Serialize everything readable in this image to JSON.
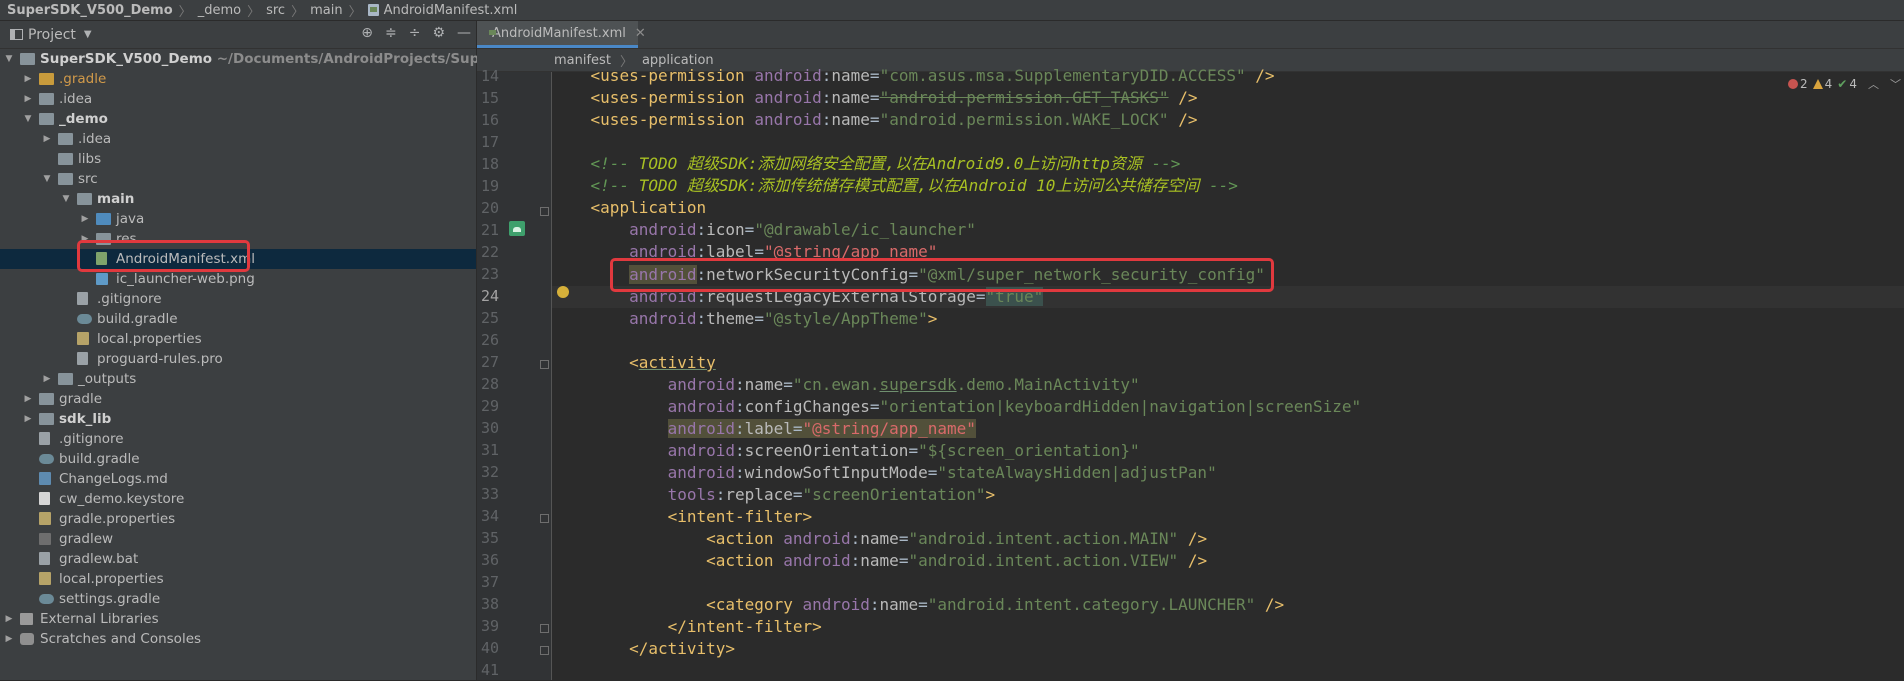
{
  "breadcrumb": {
    "items": [
      "SuperSDK_V500_Demo",
      "_demo",
      "src",
      "main",
      "AndroidManifest.xml"
    ]
  },
  "project_panel": {
    "title": "Project",
    "tree": [
      {
        "label": "SuperSDK_V500_Demo",
        "hint": "~/Documents/AndroidProjects/SuperSDK/_d",
        "bold": true,
        "arrow": "open",
        "icon": "folder"
      },
      {
        "label": ".gradle",
        "orange": true,
        "arrow": "closed",
        "icon": "folder-y"
      },
      {
        "label": ".idea",
        "arrow": "closed",
        "icon": "folder"
      },
      {
        "label": "_demo",
        "bold": true,
        "arrow": "open",
        "icon": "folder-m"
      },
      {
        "label": ".idea",
        "arrow": "closed",
        "icon": "folder"
      },
      {
        "label": "libs",
        "arrow": "none",
        "icon": "folder"
      },
      {
        "label": "src",
        "arrow": "open",
        "icon": "folder"
      },
      {
        "label": "main",
        "bold": true,
        "arrow": "open",
        "icon": "folder-m"
      },
      {
        "label": "java",
        "arrow": "closed",
        "icon": "folder-b"
      },
      {
        "label": "res",
        "arrow": "closed",
        "icon": "folder"
      },
      {
        "label": "AndroidManifest.xml",
        "arrow": "none",
        "icon": "xmlf",
        "selected": true
      },
      {
        "label": "ic_launcher-web.png",
        "arrow": "none",
        "icon": "png"
      },
      {
        "label": ".gitignore",
        "arrow": "none",
        "icon": "file"
      },
      {
        "label": "build.gradle",
        "arrow": "none",
        "icon": "gradle"
      },
      {
        "label": "local.properties",
        "arrow": "none",
        "icon": "prop"
      },
      {
        "label": "proguard-rules.pro",
        "arrow": "none",
        "icon": "file"
      },
      {
        "label": "_outputs",
        "arrow": "closed",
        "icon": "folder"
      },
      {
        "label": "gradle",
        "arrow": "closed",
        "icon": "folder"
      },
      {
        "label": "sdk_lib",
        "bold": true,
        "arrow": "closed",
        "icon": "folder-m"
      },
      {
        "label": ".gitignore",
        "arrow": "none",
        "icon": "file"
      },
      {
        "label": "build.gradle",
        "arrow": "none",
        "icon": "gradle"
      },
      {
        "label": "ChangeLogs.md",
        "arrow": "none",
        "icon": "md"
      },
      {
        "label": "cw_demo.keystore",
        "arrow": "none",
        "icon": "ks"
      },
      {
        "label": "gradle.properties",
        "arrow": "none",
        "icon": "prop"
      },
      {
        "label": "gradlew",
        "arrow": "none",
        "icon": "term"
      },
      {
        "label": "gradlew.bat",
        "arrow": "none",
        "icon": "file"
      },
      {
        "label": "local.properties",
        "arrow": "none",
        "icon": "prop"
      },
      {
        "label": "settings.gradle",
        "arrow": "none",
        "icon": "gradle"
      },
      {
        "label": "External Libraries",
        "arrow": "closed",
        "icon": "lib"
      },
      {
        "label": "Scratches and Consoles",
        "arrow": "closed",
        "icon": "scratch"
      }
    ]
  },
  "editor": {
    "tab_label": "AndroidManifest.xml",
    "structure": [
      "manifest",
      "application"
    ],
    "inspections": {
      "errors": "2",
      "warnings": "4",
      "weak_warnings": "4"
    },
    "current_line": "24",
    "lines": [
      {
        "n": "14"
      },
      {
        "n": "15"
      },
      {
        "n": "16"
      },
      {
        "n": "17"
      },
      {
        "n": "18"
      },
      {
        "n": "19"
      },
      {
        "n": "20"
      },
      {
        "n": "21"
      },
      {
        "n": "22"
      },
      {
        "n": "23"
      },
      {
        "n": "24"
      },
      {
        "n": "25"
      },
      {
        "n": "26"
      },
      {
        "n": "27"
      },
      {
        "n": "28"
      },
      {
        "n": "29"
      },
      {
        "n": "30"
      },
      {
        "n": "31"
      },
      {
        "n": "32"
      },
      {
        "n": "33"
      },
      {
        "n": "34"
      },
      {
        "n": "35"
      },
      {
        "n": "36"
      },
      {
        "n": "37"
      },
      {
        "n": "38"
      },
      {
        "n": "39"
      },
      {
        "n": "40"
      },
      {
        "n": "41"
      }
    ],
    "code": {
      "l14_tag": "uses-permission",
      "l14_ns": "android",
      "l14_attr": "name",
      "l14_val": "\"com.asus.msa.SupplementaryDID.ACCESS\"",
      "l15_tag": "uses-permission",
      "l15_ns": "android",
      "l15_attr": "name",
      "l15_val": "\"android.permission.GET_TASKS\"",
      "l16_tag": "uses-permission",
      "l16_ns": "android",
      "l16_attr": "name",
      "l16_val": "\"android.permission.WAKE_LOCK\"",
      "l18_todo": "TODO 超级SDK:添加网络安全配置,以在Android9.0上访问http资源",
      "l19_todo": "TODO 超级SDK:添加传统储存模式配置,以在Android 10上访问公共储存空间",
      "l20_tag": "application",
      "l21_ns": "android",
      "l21_attr": "icon",
      "l21_val": "\"@drawable/ic_launcher\"",
      "l22_ns": "android",
      "l22_attr": "label",
      "l22_val": "\"@string/app_name\"",
      "l23_ns": "android",
      "l23_attr": "networkSecurityConfig",
      "l23_val": "\"@xml/super_network_security_config\"",
      "l24_ns": "android",
      "l24_attr": "requestLegacyExternalStorage",
      "l24_val": "\"true\"",
      "l25_ns": "android",
      "l25_attr": "theme",
      "l25_val": "\"@style/AppTheme\"",
      "l27_tag": "activity",
      "l28_ns": "android",
      "l28_attr": "name",
      "l28_val_a": "\"cn.ewan.",
      "l28_val_b": "supersdk",
      "l28_val_c": ".demo.MainActivity\"",
      "l29_ns": "android",
      "l29_attr": "configChanges",
      "l29_val": "\"orientation|keyboardHidden|navigation|screenSize\"",
      "l30_ns": "android",
      "l30_attr": "label",
      "l30_val": "\"@string/app_name\"",
      "l31_ns": "android",
      "l31_attr": "screenOrientation",
      "l31_val": "\"${screen_orientation}\"",
      "l32_ns": "android",
      "l32_attr": "windowSoftInputMode",
      "l32_val": "\"stateAlwaysHidden|adjustPan\"",
      "l33_ns": "tools",
      "l33_attr": "replace",
      "l33_val": "\"screenOrientation\"",
      "l34_tag": "intent-filter",
      "l35_tag": "action",
      "l35_ns": "android",
      "l35_attr": "name",
      "l35_val": "\"android.intent.action.MAIN\"",
      "l36_tag": "action",
      "l36_ns": "android",
      "l36_attr": "name",
      "l36_val": "\"android.intent.action.VIEW\"",
      "l38_tag": "category",
      "l38_ns": "android",
      "l38_attr": "name",
      "l38_val": "\"android.intent.category.LAUNCHER\"",
      "l39_tag": "intent-filter",
      "l40_tag": "activity"
    }
  }
}
